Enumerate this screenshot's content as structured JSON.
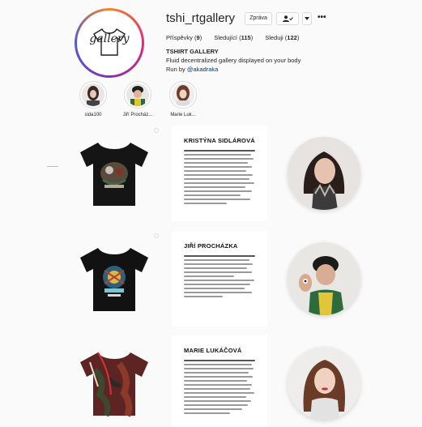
{
  "profile": {
    "username": "tshi_rtgallery",
    "avatar_text": "gallery",
    "buttons": {
      "message": "Zpráva",
      "follow_icon": "person-check-icon",
      "dropdown_icon": "chevron-down-icon",
      "more": "•••"
    },
    "stats": [
      {
        "label": "Příspěvky",
        "value": "9"
      },
      {
        "label": "Sledující",
        "value": "115"
      },
      {
        "label": "Sleduji",
        "value": "122"
      }
    ],
    "bio": {
      "name": "TSHIRT GALLERY",
      "description": "Fluid decentralized gallery displayed on your body",
      "run_by_prefix": "Run by ",
      "run_by_handle": "@akadraka"
    }
  },
  "highlights": [
    {
      "label": "sida100"
    },
    {
      "label": "Jiří Procház..."
    },
    {
      "label": "Marie Luk..."
    }
  ],
  "posts": [
    {
      "type": "photo",
      "icon": "black-tshirt-icon"
    },
    {
      "type": "text",
      "title": "KRISTÝNA SIDLÁROVÁ"
    },
    {
      "type": "portrait",
      "icon": "woman-portrait-icon"
    },
    {
      "type": "photo",
      "icon": "black-tshirt-icon"
    },
    {
      "type": "text",
      "title": "JIŘÍ PROCHÁZKA"
    },
    {
      "type": "portrait",
      "icon": "man-portrait-icon"
    },
    {
      "type": "photo",
      "icon": "tiedye-tshirt-icon"
    },
    {
      "type": "text",
      "title": "MARIE LUKÁČOVÁ"
    },
    {
      "type": "portrait",
      "icon": "woman-portrait-icon"
    }
  ],
  "colors": {
    "background": "#fafafa",
    "border": "#dbdbdb",
    "text": "#262626",
    "link": "#00376b"
  }
}
